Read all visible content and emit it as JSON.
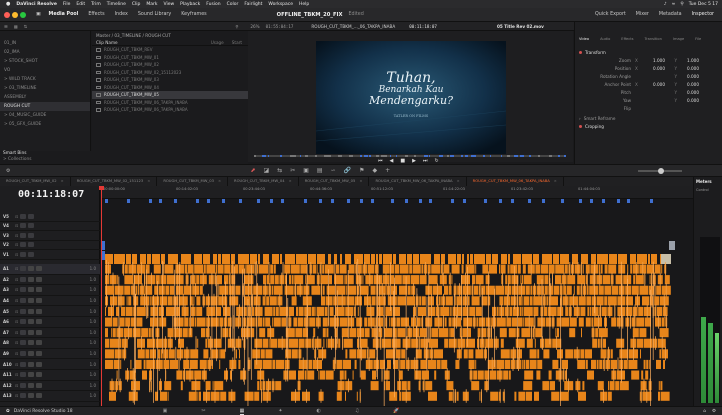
{
  "menubar": {
    "app_name": "DaVinci Resolve",
    "items": [
      "File",
      "Edit",
      "Trim",
      "Timeline",
      "Clip",
      "Mark",
      "View",
      "Playback",
      "Fusion",
      "Color",
      "Fairlight",
      "Workspace",
      "Help"
    ],
    "clock": "Tue Dec 5 17"
  },
  "toolbar": {
    "media_pool": "Media Pool",
    "effects": "Effects",
    "index": "Index",
    "sound_library": "Sound Library",
    "keyframes": "Keyframes",
    "project_title": "OFFLINE_TBKM_20_FIX",
    "project_state": "Edited",
    "quick_export": "Quick Export",
    "mixer": "Mixer",
    "metadata": "Metadata",
    "inspector": "Inspector"
  },
  "strip2": {
    "zoom": "26%",
    "src_tc": "01:55:04:17",
    "timeline_name": "ROUGH_CUT_TBKM_..._06_TAKPA_INABA",
    "rec_tc": "00:11:18:07",
    "clip_name": "05 Title Rev 02.mov"
  },
  "bins": {
    "items": [
      {
        "label": "01_IN"
      },
      {
        "label": "02_IMA"
      },
      {
        "label": "> STOCK_SHOT"
      },
      {
        "label": "VO"
      },
      {
        "label": "> WILD TRACK"
      },
      {
        "label": "> 03_TIMELINE"
      },
      {
        "label": "ASSEMBLY"
      },
      {
        "label": "ROUGH CUT"
      },
      {
        "label": "> 04_MUSIC_GUIDE"
      },
      {
        "label": "> 05_GFX_GUIDE"
      }
    ],
    "selected_index": 7
  },
  "cliplist": {
    "path": "Master / 03_TIMELINE / ROUGH CUT",
    "header_name": "Clip Name",
    "header_col2": "Usage",
    "header_col3": "Start",
    "clips": [
      {
        "name": "ROUGH_CUT_TBKM_REV"
      },
      {
        "name": "ROUGH_CUT_TBKM_MW_01"
      },
      {
        "name": "ROUGH_CUT_TBKM_MW_02"
      },
      {
        "name": "ROUGH_CUT_TBKM_MW_02_15112023"
      },
      {
        "name": "ROUGH_CUT_TBKM_MW_03"
      },
      {
        "name": "ROUGH_CUT_TBKM_MW_04"
      },
      {
        "name": "ROUGH_CUT_TBKM_MW_05"
      },
      {
        "name": "ROUGH_CUT_TBKM_MW_06_TAKPA_INABA"
      },
      {
        "name": "ROUGH_CUT_TBKM_MW_06_TAKPA_INABA"
      }
    ],
    "selected_index": 6
  },
  "smartbins": {
    "title": "Smart Bins",
    "item": "> Collections"
  },
  "viewer": {
    "title_line1": "Tuhan,",
    "title_line2": "Benarkah Kau",
    "title_line3": "Mendengarku?",
    "subtitle": "TATLER ON FILMS"
  },
  "inspector": {
    "tabs": [
      "Video",
      "Audio",
      "Effects",
      "Transition",
      "Image",
      "File"
    ],
    "section_transform": "Transform",
    "rows": [
      {
        "label": "Zoom",
        "x": "1.000",
        "y": "1.000"
      },
      {
        "label": "Position",
        "x": "0.000",
        "y": "0.000"
      },
      {
        "label": "Rotation Angle",
        "x": "",
        "y": "0.000"
      },
      {
        "label": "Anchor Point",
        "x": "0.000",
        "y": "0.000"
      },
      {
        "label": "Pitch",
        "x": "",
        "y": "0.000"
      },
      {
        "label": "Yaw",
        "x": "",
        "y": "0.000"
      },
      {
        "label": "Flip",
        "x": "",
        "y": ""
      }
    ],
    "section_smart_reframe": "Smart Reframe",
    "section_cropping": "Cropping"
  },
  "timeline": {
    "timecode": "00:11:18:07",
    "tabs": [
      "ROUGH_CUT_TBKM_MW_02",
      "ROUGH_CUT_TBKM_MW_02_151123",
      "ROUGH_CUT_TBKM_MW_03",
      "ROUGH_CUT_TBKM_MW_04",
      "ROUGH_CUT_TBKM_MW_05",
      "ROUGH_CUT_TBKM_MW_06_TAKPA_INABA",
      "ROUGH_CUT_TBKM_MW_06_TAKPA_INABA"
    ],
    "active_tab": 6,
    "ruler_ticks": [
      "00:00:00:00",
      "00:14:02:03",
      "00:23:44:03",
      "00:44:36:03",
      "00:51:12:03",
      "01:14:22:03",
      "01:23:42:03",
      "01:44:04:03"
    ],
    "video_tracks": [
      "V5",
      "V4",
      "V3",
      "V2",
      "V1"
    ],
    "audio_tracks": [
      "A1",
      "A2",
      "A3",
      "A4",
      "A5",
      "A6",
      "A7",
      "A8",
      "A9",
      "A10",
      "A11",
      "A12",
      "A13"
    ],
    "audio_values": [
      "1.0",
      "1.0",
      "1.0",
      "1.0",
      "1.0",
      "1.0",
      "1.0",
      "1.0",
      "1.0",
      "1.0",
      "1.0",
      "1.0",
      "1.0"
    ]
  },
  "meters": {
    "title": "Meters",
    "label": "Control"
  },
  "footer": {
    "app": "DaVinci Resolve Studio 18"
  },
  "colors": {
    "accent_orange": "#e8851a",
    "clip_blue": "#3f6fd0",
    "active_red": "#e53935"
  }
}
